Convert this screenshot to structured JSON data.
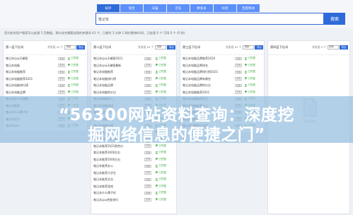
{
  "tabs": [
    {
      "label": "知乎",
      "active": true
    },
    {
      "label": "淘宝",
      "active": false
    },
    {
      "label": "天猫",
      "active": false
    },
    {
      "label": "京东",
      "active": false
    },
    {
      "label": "拼多多",
      "active": false
    },
    {
      "label": "抖音",
      "active": false
    },
    {
      "label": "百度移动",
      "active": false
    }
  ],
  "search": {
    "value": "笔记本",
    "button_label": "搜索"
  },
  "stats_text": "您分析的用户搜索可以处理 5 页数据，预计该共需要处理的关键词 43 个，已耗时 3 分钟 1.8秒(最快时间)，已处理 0 个 可用 0 个 (0 秒)",
  "columns": [
    {
      "title": "第一层下拉词",
      "ctrl_text": "共发现 25 个",
      "select": "排序",
      "button": "导出",
      "sub": "",
      "rows": [
        {
          "name": "笔记本cpu天梯图",
          "mini": "查询",
          "status": "已挖掘"
        },
        {
          "name": "笔记本电脑",
          "mini": "查询",
          "status": "已挖掘"
        },
        {
          "name": "笔记本电脑推荐",
          "mini": "查询",
          "status": "已挖掘"
        },
        {
          "name": "笔记本电脑推荐2021",
          "mini": "查询",
          "status": "已挖掘"
        },
        {
          "name": "笔记本电脑排行榜",
          "mini": "查询",
          "status": "已挖掘"
        },
        {
          "name": "笔记本电脑品牌",
          "mini": "查询",
          "status": "已挖掘"
        },
        {
          "name": "笔记本显卡天梯图",
          "mini": "查询",
          "status": "已挖掘"
        },
        {
          "name": "笔记本推荐",
          "mini": "查询",
          "status": "已挖掘"
        },
        {
          "name": "笔记本什么牌子好",
          "mini": "查询",
          "status": "已挖掘"
        },
        {
          "name": "笔记本显卡",
          "mini": "查询",
          "status": "已挖掘"
        },
        {
          "name": "笔记本cpu",
          "mini": "查询",
          "status": "已挖掘"
        }
      ]
    },
    {
      "title": "第二层下拉词",
      "ctrl_text": "共发现 63 个",
      "select": "排序",
      "button": "导出",
      "sub": "",
      "rows": [
        {
          "name": "笔记本cpu天梯图2021",
          "mini": "查询",
          "status": "已挖掘"
        },
        {
          "name": "笔记本cpu天梯图最新",
          "mini": "查询",
          "status": "已挖掘"
        },
        {
          "name": "笔记本电脑推荐",
          "mini": "查询",
          "status": "已挖掘"
        },
        {
          "name": "笔记本电脑排行榜",
          "mini": "查询",
          "status": "已挖掘"
        },
        {
          "name": "笔记本电脑品牌",
          "mini": "查询",
          "status": "已挖掘"
        },
        {
          "name": "笔记本电脑性价比",
          "mini": "查询",
          "status": "已挖掘"
        },
        {
          "name": "笔记本电脑办公",
          "mini": "查询",
          "status": "已挖掘"
        },
        {
          "name": "笔记本电脑游戏",
          "mini": "查询",
          "status": "已挖掘"
        },
        {
          "name": "笔记本电脑学生",
          "mini": "查询",
          "status": "已挖掘"
        },
        {
          "name": "笔记本电脑轻薄",
          "mini": "查询",
          "status": "已挖掘"
        },
        {
          "name": "笔记本电脑价格",
          "mini": "查询",
          "status": "已挖掘"
        },
        {
          "name": "笔记本推荐2021",
          "mini": "查询",
          "status": "已挖掘"
        },
        {
          "name": "笔记本推荐2021轻薄本",
          "mini": "查询",
          "status": "已挖掘"
        },
        {
          "name": "笔记本推荐2021款性价",
          "mini": "查询",
          "status": "已挖掘"
        },
        {
          "name": "笔记本推荐3000左右",
          "mini": "查询",
          "status": "已挖掘"
        },
        {
          "name": "笔记本推荐5000左右",
          "mini": "查询",
          "status": "已挖掘"
        },
        {
          "name": "笔记本推荐办公",
          "mini": "查询",
          "status": "已挖掘"
        },
        {
          "name": "笔记本推荐大学生",
          "mini": "查询",
          "status": "已挖掘"
        },
        {
          "name": "笔记本推荐文员",
          "mini": "查询",
          "status": "已挖掘"
        },
        {
          "name": "笔记本推荐游戏",
          "mini": "查询",
          "status": "已挖掘"
        },
        {
          "name": "笔记本什么牌子好",
          "mini": "查询",
          "status": "已挖掘"
        },
        {
          "name": "笔记本cpu性能排行",
          "mini": "查询",
          "status": "已挖掘"
        }
      ]
    },
    {
      "title": "第三层下拉词",
      "ctrl_text": "共发现 53 个",
      "select": "排序",
      "button": "导出",
      "sub": "",
      "rows": [
        {
          "name": "笔记本电脑品牌推荐2020",
          "mini": "查询",
          "status": "已挖掘"
        },
        {
          "name": "笔记本电脑品牌排名",
          "mini": "查询",
          "status": "已挖掘"
        },
        {
          "name": "笔记本电脑品牌排行榜2021",
          "mini": "查询",
          "status": "已挖掘"
        },
        {
          "name": "笔记本电脑品牌有哪些",
          "mini": "查询",
          "status": "已挖掘"
        },
        {
          "name": "笔记本电脑品牌性价比",
          "mini": "查询",
          "status": "已挖掘"
        },
        {
          "name": "笔记本电脑推荐2021",
          "mini": "查询",
          "status": "已挖掘"
        },
        {
          "name": "笔记本电脑推荐学生",
          "mini": "查询",
          "status": "已挖掘"
        },
        {
          "name": "笔记本电脑推荐办公",
          "mini": "查询",
          "status": "已挖掘"
        },
        {
          "name": "笔记本电脑推荐游戏",
          "mini": "查询",
          "status": "已挖掘"
        },
        {
          "name": "笔记本电脑推荐轻薄",
          "mini": "查询",
          "status": "已挖掘"
        },
        {
          "name": "笔记本电脑性价比高",
          "mini": "查询",
          "status": "已挖掘"
        }
      ]
    },
    {
      "title": "第四层下拉词",
      "ctrl_text": "共发现 0 个",
      "select": "排序",
      "button": "导出",
      "sub": "",
      "rows": []
    }
  ],
  "empty_text": "暂无数据",
  "banner": {
    "line1": "“56300网站资料查询：深度挖",
    "line2": "掘网络信息的便捷之门”"
  }
}
